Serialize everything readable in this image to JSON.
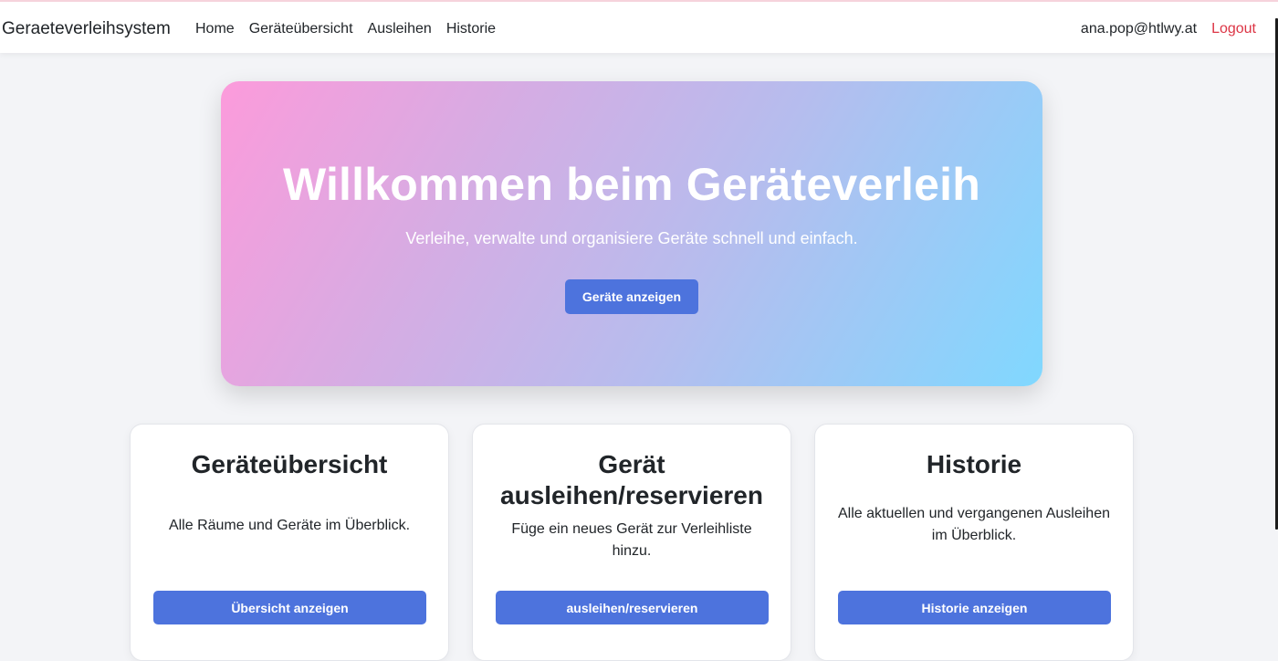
{
  "navbar": {
    "brand": "Geraeteverleihsystem",
    "links": [
      "Home",
      "Geräteübersicht",
      "Ausleihen",
      "Historie"
    ],
    "user_email": "ana.pop@htlwy.at",
    "logout_label": "Logout"
  },
  "hero": {
    "title": "Willkommen beim Geräteverleih",
    "subtitle": "Verleihe, verwalte und organisiere Geräte schnell und einfach.",
    "button_label": "Geräte anzeigen"
  },
  "cards": [
    {
      "title": "Geräteübersicht",
      "text": "Alle Räume und Geräte im Überblick.",
      "button_label": "Übersicht anzeigen"
    },
    {
      "title": "Gerät ausleihen/reservieren",
      "text": "Füge ein neues Gerät zur Verleihliste hinzu.",
      "button_label": "ausleihen/reservieren"
    },
    {
      "title": "Historie",
      "text": "Alle aktuellen und vergangenen Ausleihen im Überblick.",
      "button_label": "Historie anzeigen"
    }
  ],
  "colors": {
    "primary_button": "#4d73dd",
    "logout": "#dc3545",
    "background": "#f3f4f7"
  }
}
